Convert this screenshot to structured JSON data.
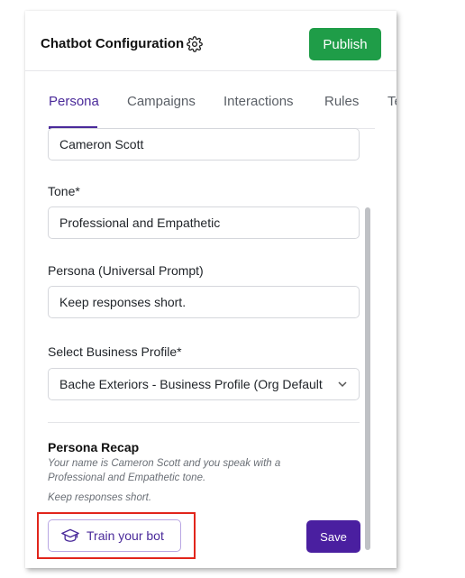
{
  "header": {
    "title": "Chatbot Configuration",
    "publish_label": "Publish"
  },
  "tabs": [
    {
      "label": "Persona",
      "active": true
    },
    {
      "label": "Campaigns"
    },
    {
      "label": "Interactions"
    },
    {
      "label": "Rules"
    },
    {
      "label": "Te"
    }
  ],
  "form": {
    "name_value": "Cameron Scott",
    "tone_label": "Tone*",
    "tone_value": "Professional and Empathetic",
    "persona_label": "Persona (Universal Prompt)",
    "persona_value": "Keep responses short.",
    "business_label": "Select Business Profile*",
    "business_value": "Bache Exteriors - Business Profile (Org Default"
  },
  "recap": {
    "title": "Persona Recap",
    "text": "Your name is Cameron Scott and you speak with a Professional and Empathetic tone.",
    "extra": "Keep responses short."
  },
  "actions": {
    "train_label": "Train your bot",
    "save_label": "Save"
  },
  "colors": {
    "accent": "#4a2a9a",
    "publish": "#1f9d48",
    "save": "#4a1fa0",
    "highlight": "#e1251b"
  }
}
